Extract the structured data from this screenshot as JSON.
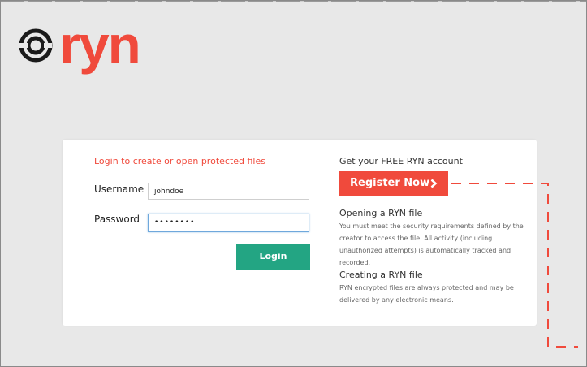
{
  "brand": {
    "name": "ryn"
  },
  "login": {
    "heading": "Login to create or open protected files",
    "username_label": "Username",
    "username_value": "johndoe",
    "password_label": "Password",
    "password_mask": "••••••••",
    "login_button": "Login"
  },
  "register": {
    "title": "Get your FREE RYN account",
    "button_label": "Register Now"
  },
  "info": {
    "opening_title": "Opening a RYN file",
    "opening_text": "You must meet the security requirements defined by the creator to access the file. All activity (including unauthorized attempts) is automatically tracked and recorded.",
    "creating_title": "Creating a RYN file",
    "creating_text": "RYN encrypted files are always protected and may be delivered by any electronic means."
  },
  "colors": {
    "brand_red": "#f04a3c",
    "login_green": "#23a583",
    "background": "#e8e8e8"
  },
  "icons": [
    "logo-ring-icon",
    "chevron-right-icon"
  ]
}
